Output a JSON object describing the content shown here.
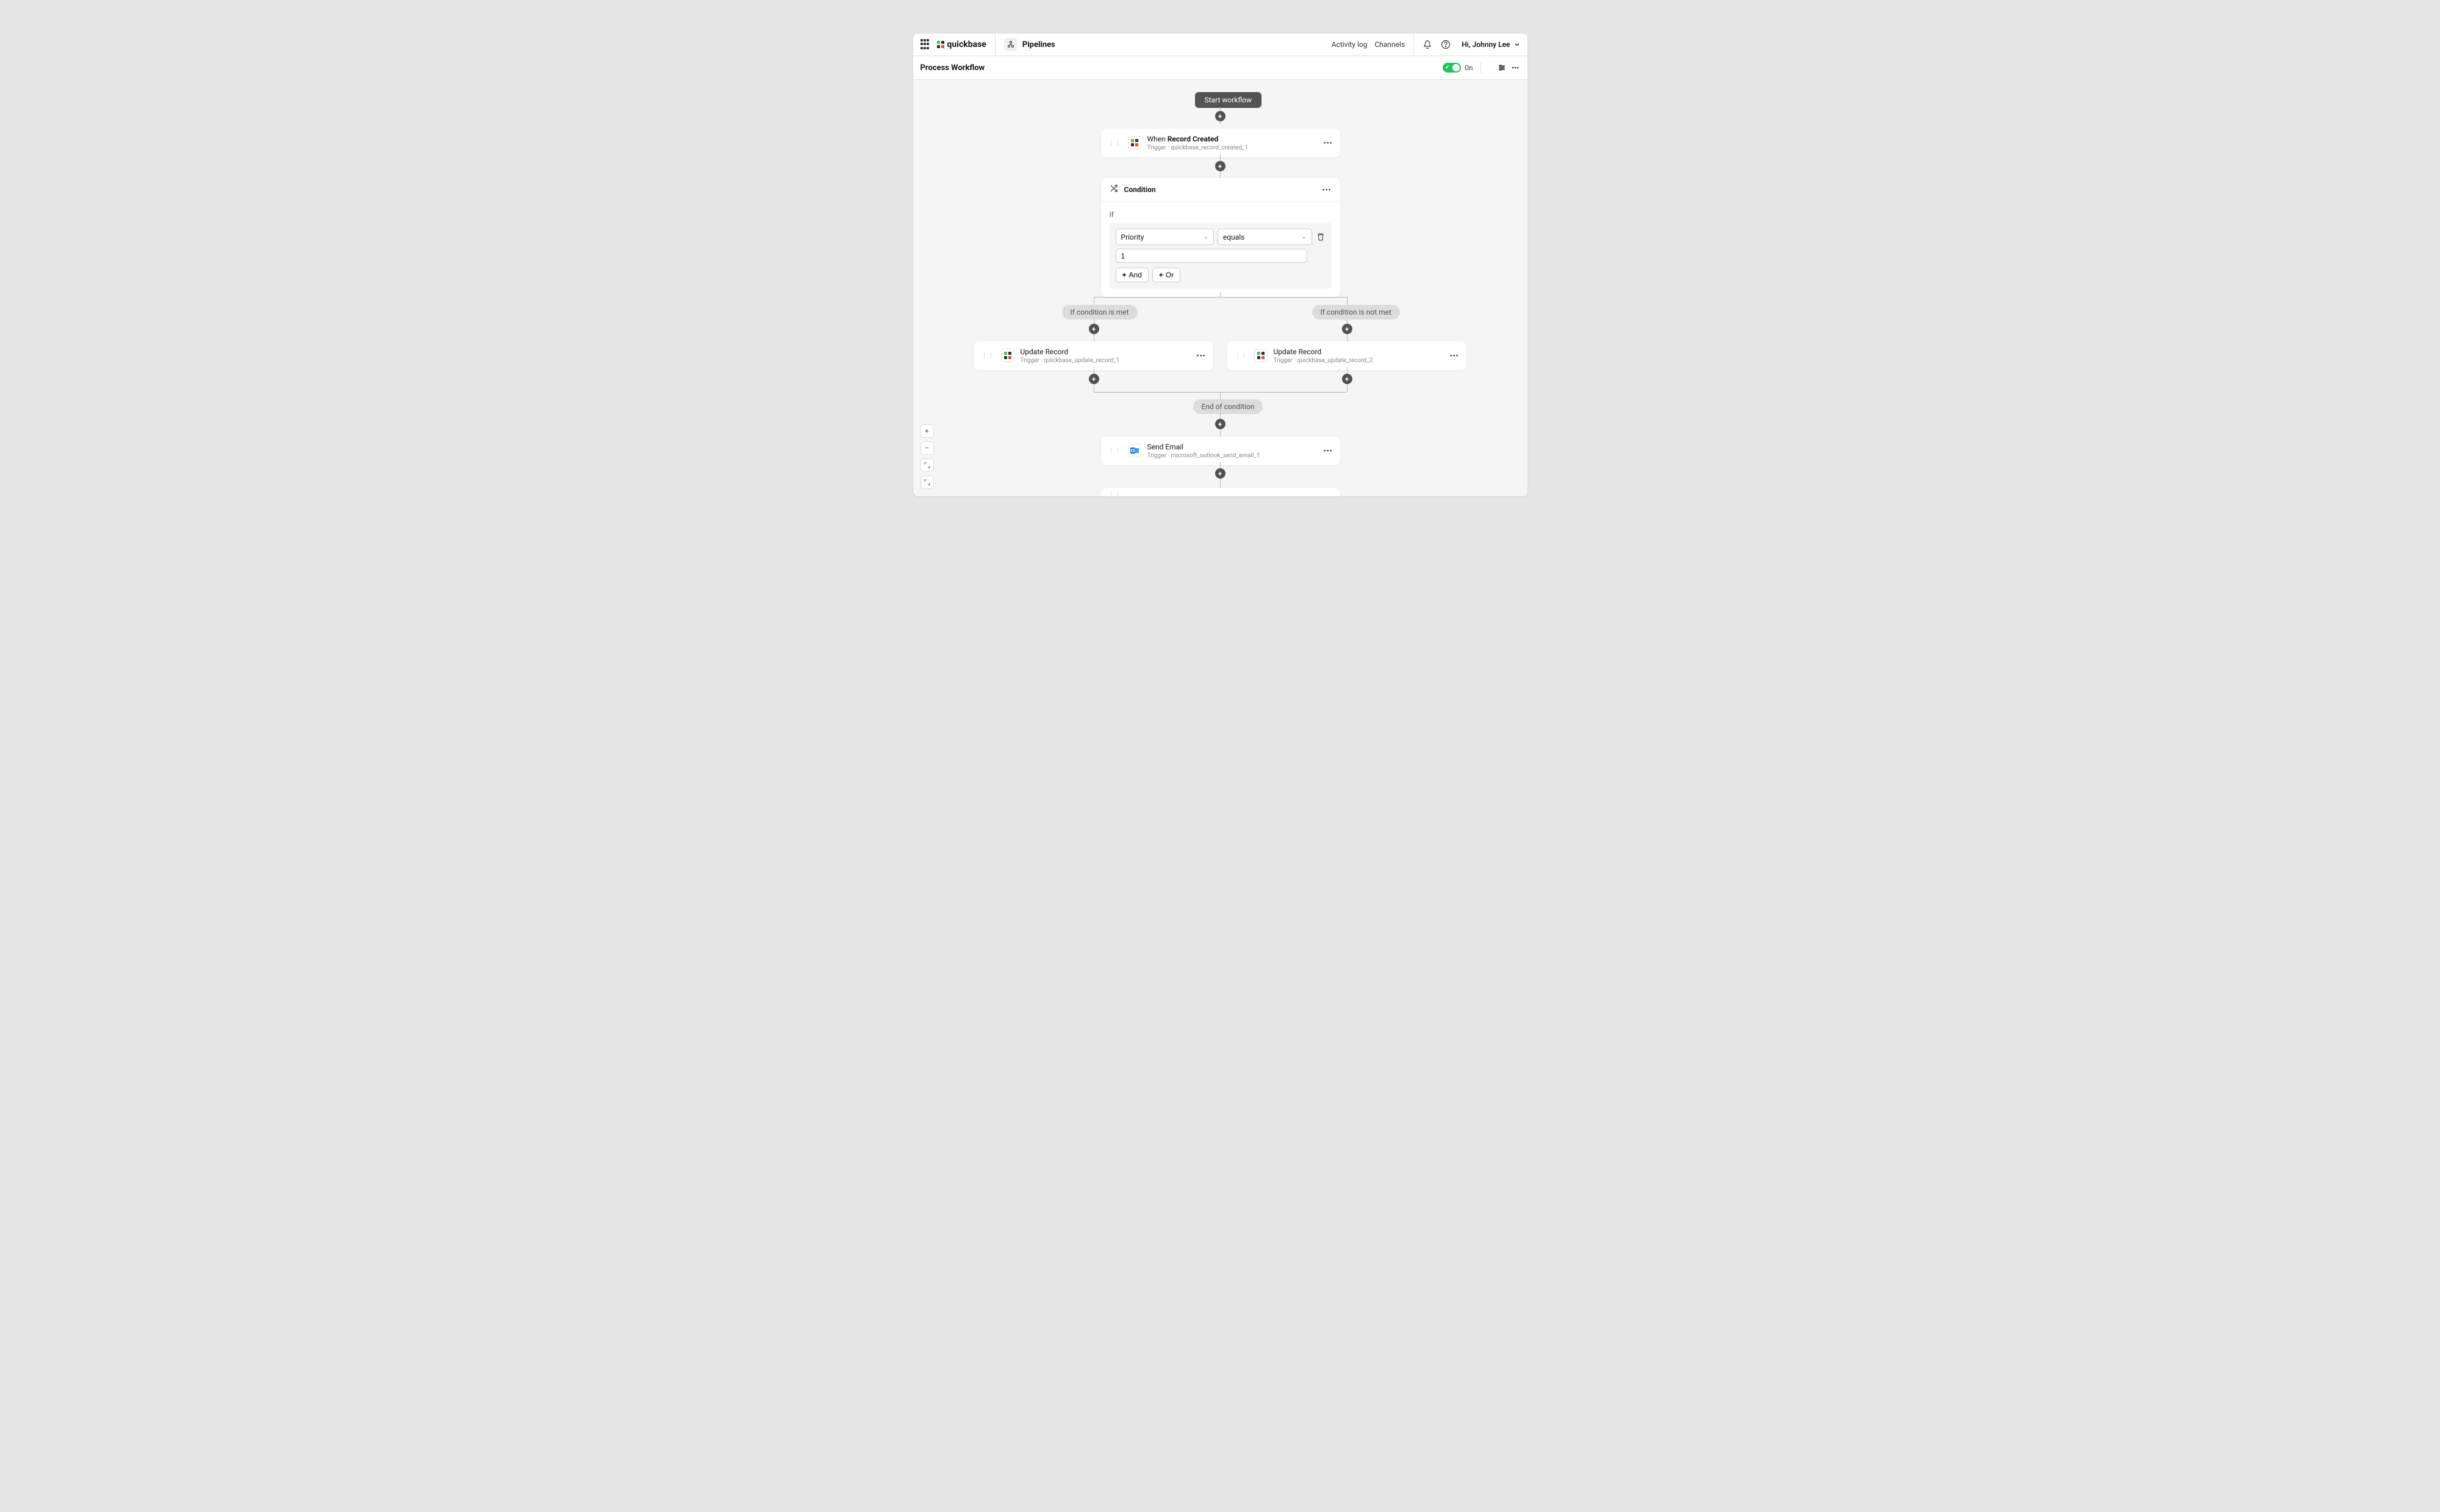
{
  "header": {
    "logo": "quickbase",
    "section": "Pipelines",
    "activity_log": "Activity log",
    "channels": "Channels",
    "user": "Hi, Johnny Lee"
  },
  "subheader": {
    "title": "Process Workflow",
    "toggle_label": "On"
  },
  "workflow": {
    "start": "Start workflow",
    "trigger_card": {
      "when": "When ",
      "event": "Record Created",
      "sub": "Trigger · quickbase_record_created_1"
    },
    "condition": {
      "title": "Condition",
      "if_label": "If",
      "field": "Priority",
      "operator": "equals",
      "value": "1",
      "and": "And",
      "or": "Or"
    },
    "branch_met": "If condition is met",
    "branch_not_met": "If condition is not met",
    "update_left": {
      "title": "Update Record",
      "sub": "Trigger · quickbase_update_record_1"
    },
    "update_right": {
      "title": "Update Record",
      "sub": "Trigger · quickbase_update_record_2"
    },
    "end_condition": "End of condition",
    "send_email": {
      "title": "Send Email",
      "sub": "Trigger · microsoft_outlook_send_email_1"
    }
  }
}
